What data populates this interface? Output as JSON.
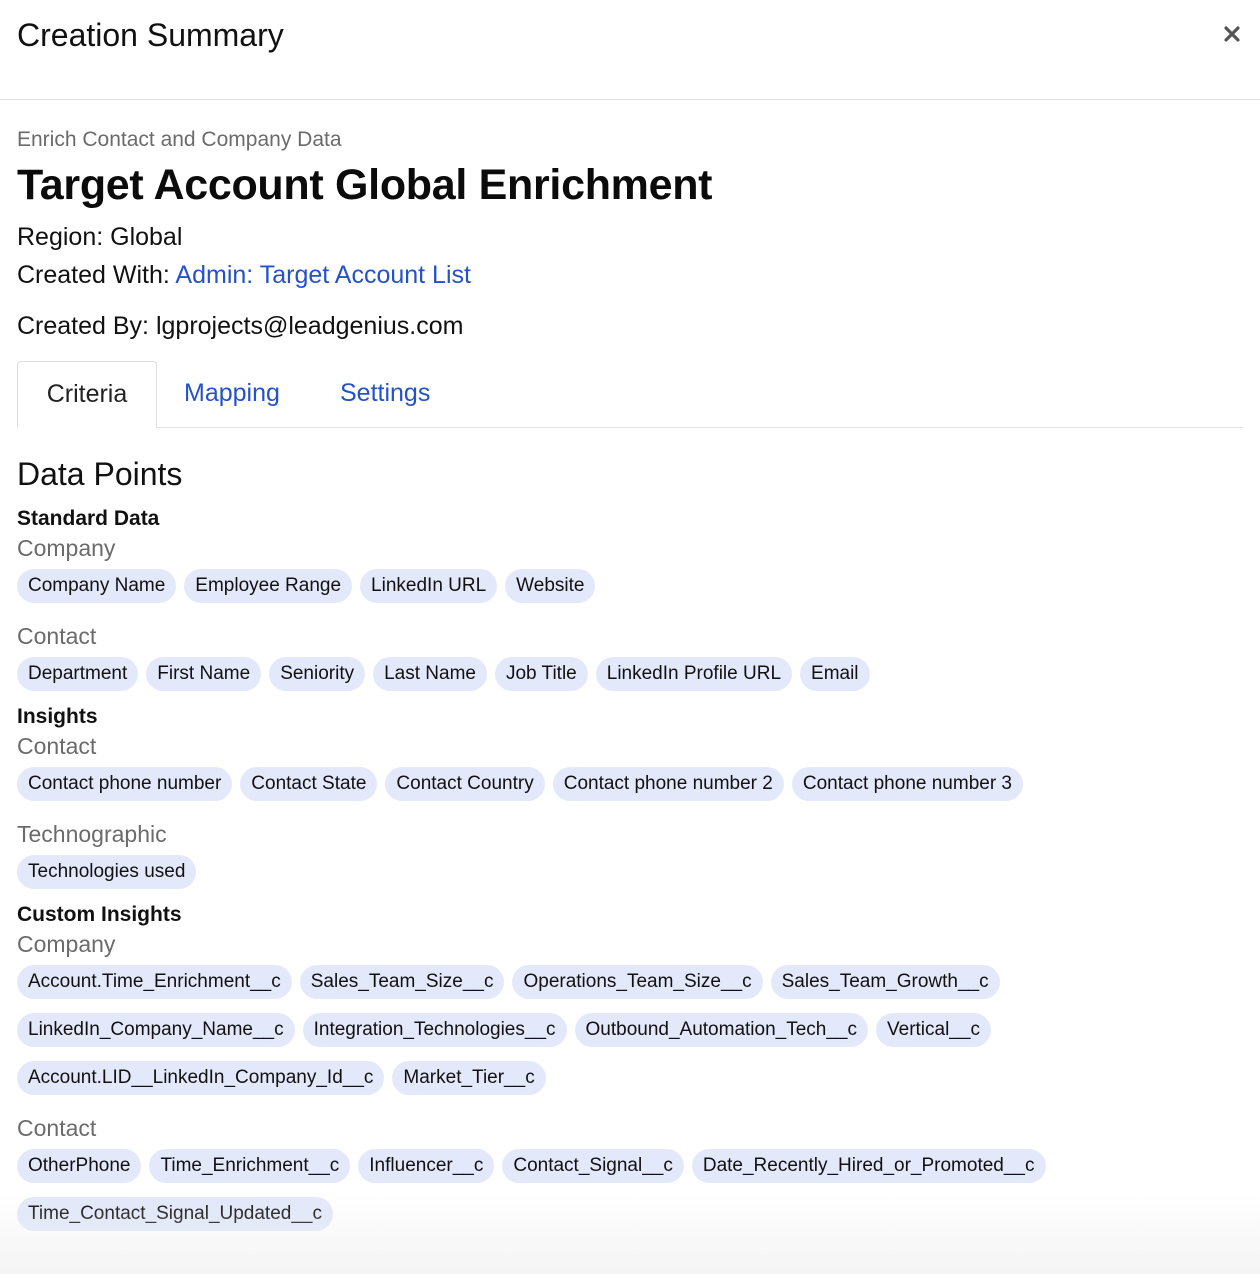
{
  "modal": {
    "title": "Creation Summary",
    "close_icon": "close-icon"
  },
  "summary": {
    "category": "Enrich Contact and Company Data",
    "title": "Target Account Global Enrichment",
    "region_label": "Region:",
    "region_value": "Global",
    "created_with_label": "Created With:",
    "created_with_value": "Admin: Target Account List",
    "created_by_label": "Created By:",
    "created_by_value": "lgprojects@leadgenius.com"
  },
  "tabs": [
    {
      "label": "Criteria",
      "active": true
    },
    {
      "label": "Mapping",
      "active": false
    },
    {
      "label": "Settings",
      "active": false
    }
  ],
  "data_points": {
    "heading": "Data Points",
    "standard_data": {
      "title": "Standard Data",
      "company_label": "Company",
      "company_items": [
        "Company Name",
        "Employee Range",
        "LinkedIn URL",
        "Website"
      ],
      "contact_label": "Contact",
      "contact_items": [
        "Department",
        "First Name",
        "Seniority",
        "Last Name",
        "Job Title",
        "LinkedIn Profile URL",
        "Email"
      ]
    },
    "insights": {
      "title": "Insights",
      "contact_label": "Contact",
      "contact_items": [
        "Contact phone number",
        "Contact State",
        "Contact Country",
        "Contact phone number 2",
        "Contact phone number 3"
      ],
      "technographic_label": "Technographic",
      "technographic_items": [
        "Technologies used"
      ]
    },
    "custom_insights": {
      "title": "Custom Insights",
      "company_label": "Company",
      "company_items": [
        "Account.Time_Enrichment__c",
        "Sales_Team_Size__c",
        "Operations_Team_Size__c",
        "Sales_Team_Growth__c",
        "LinkedIn_Company_Name__c",
        "Integration_Technologies__c",
        "Outbound_Automation_Tech__c",
        "Vertical__c",
        "Account.LID__LinkedIn_Company_Id__c",
        "Market_Tier__c"
      ],
      "contact_label": "Contact",
      "contact_items": [
        "OtherPhone",
        "Time_Enrichment__c",
        "Influencer__c",
        "Contact_Signal__c",
        "Date_Recently_Hired_or_Promoted__c",
        "Time_Contact_Signal_Updated__c"
      ]
    }
  },
  "colors": {
    "link": "#2452c7",
    "chip_bg": "#e3e9fb",
    "muted_text": "#6b6b6b"
  }
}
